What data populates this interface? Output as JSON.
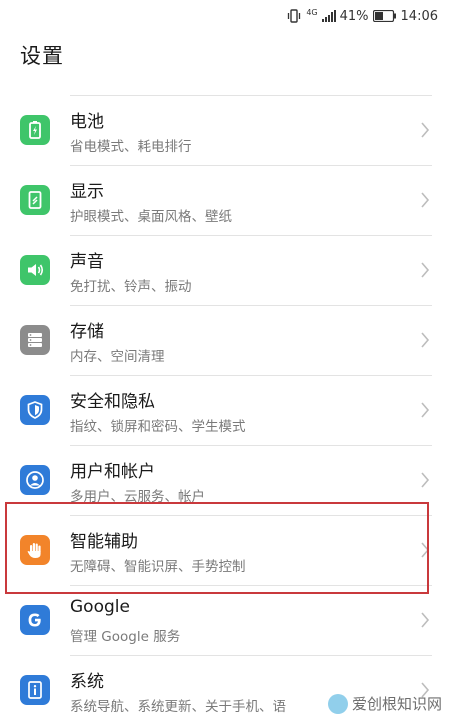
{
  "status_bar": {
    "network": "4G",
    "battery": "41%",
    "time": "14:06"
  },
  "header": {
    "title": "设置"
  },
  "colors": {
    "green": "#3fc56a",
    "gray": "#8c8c8c",
    "blue": "#2f7bd8",
    "orange": "#f2842a",
    "highlight": "#c9393c"
  },
  "items": [
    {
      "title": "电池",
      "subtitle": "省电模式、耗电排行",
      "icon": "battery-icon",
      "color": "#3fc56a"
    },
    {
      "title": "显示",
      "subtitle": "护眼模式、桌面风格、壁纸",
      "icon": "display-icon",
      "color": "#3fc56a"
    },
    {
      "title": "声音",
      "subtitle": "免打扰、铃声、振动",
      "icon": "speaker-icon",
      "color": "#3fc56a"
    },
    {
      "title": "存储",
      "subtitle": "内存、空间清理",
      "icon": "storage-icon",
      "color": "#8c8c8c"
    },
    {
      "title": "安全和隐私",
      "subtitle": "指纹、锁屏和密码、学生模式",
      "icon": "shield-icon",
      "color": "#2f7bd8"
    },
    {
      "title": "用户和帐户",
      "subtitle": "多用户、云服务、帐户",
      "icon": "user-icon",
      "color": "#2f7bd8"
    },
    {
      "title": "智能辅助",
      "subtitle": "无障碍、智能识屏、手势控制",
      "icon": "hand-icon",
      "color": "#f2842a"
    },
    {
      "title": "Google",
      "subtitle": "管理 Google 服务",
      "icon": "google-icon",
      "color": "#2f7bd8"
    },
    {
      "title": "系统",
      "subtitle": "系统导航、系统更新、关于手机、语",
      "icon": "info-icon",
      "color": "#2f7bd8"
    }
  ],
  "watermark": {
    "text": "爱创根知识网"
  }
}
